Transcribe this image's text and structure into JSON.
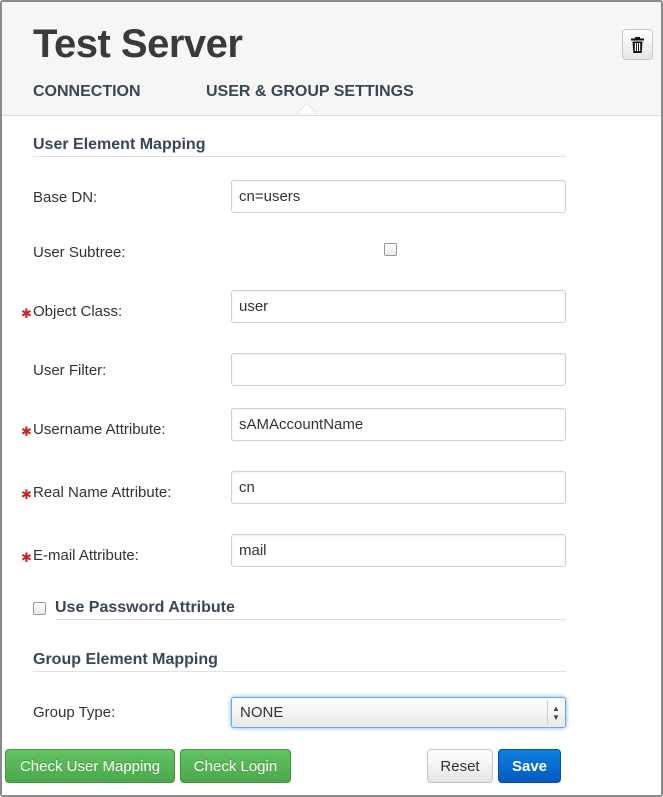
{
  "header": {
    "title": "Test Server",
    "tabs": [
      {
        "label": "CONNECTION",
        "active": false
      },
      {
        "label": "USER & GROUP SETTINGS",
        "active": true
      }
    ]
  },
  "user_mapping": {
    "section_title": "User Element Mapping",
    "base_dn": {
      "label": "Base DN:",
      "value": "cn=users"
    },
    "user_subtree": {
      "label": "User Subtree:",
      "checked": false
    },
    "object_class": {
      "label": "Object Class:",
      "value": "user",
      "required": true
    },
    "user_filter": {
      "label": "User Filter:",
      "value": ""
    },
    "username_attribute": {
      "label": "Username Attribute:",
      "value": "sAMAccountName",
      "required": true
    },
    "real_name_attribute": {
      "label": "Real Name Attribute:",
      "value": "cn",
      "required": true
    },
    "email_attribute": {
      "label": "E-mail Attribute:",
      "value": "mail",
      "required": true
    },
    "required_marker": "✱"
  },
  "password_attribute": {
    "label": "Use Password Attribute",
    "checked": false
  },
  "group_mapping": {
    "section_title": "Group Element Mapping",
    "group_type": {
      "label": "Group Type:",
      "value": "NONE"
    }
  },
  "actions": {
    "check_user_mapping": "Check User Mapping",
    "check_login": "Check Login",
    "reset": "Reset",
    "save": "Save"
  },
  "colors": {
    "green": "#5cb85c",
    "primary": "#0a6fd6",
    "required": "#cc2222"
  }
}
